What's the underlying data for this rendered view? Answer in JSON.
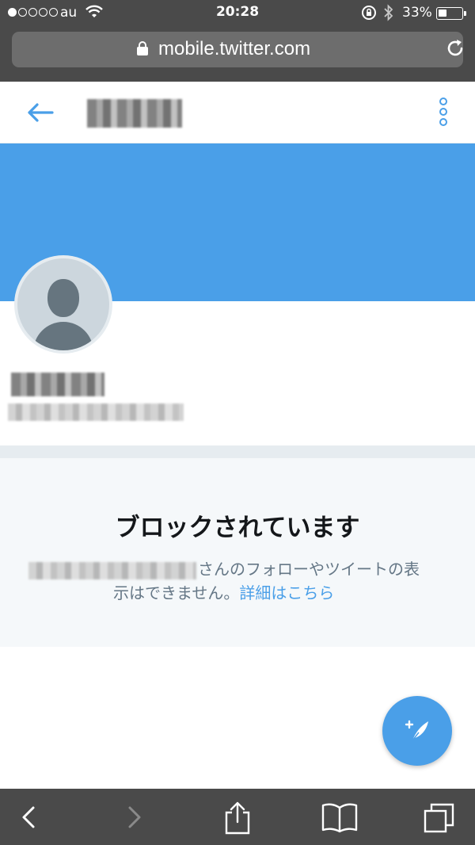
{
  "status_bar": {
    "carrier": "au",
    "time": "20:28",
    "battery": "33%",
    "battery_level": 0.33,
    "signal_bars_filled": 1,
    "signal_bars_total": 5
  },
  "browser": {
    "url": "mobile.twitter.com"
  },
  "header": {
    "back_icon": "arrow-left-icon",
    "more_icon": "more-vertical-icon"
  },
  "blocked": {
    "title": "ブロックされています",
    "line1_suffix": "さんのフォローやツイートの表",
    "line2_prefix": "示はできません。",
    "learn_more": "詳細はこちら"
  },
  "toolbar": {
    "icons": [
      "back-icon",
      "forward-icon",
      "share-icon",
      "bookmarks-icon",
      "tabs-icon"
    ]
  },
  "colors": {
    "brand": "#4a9fe8",
    "chrome": "#4a4a4a",
    "section_bg": "#f5f8fa",
    "muted_text": "#657786"
  }
}
